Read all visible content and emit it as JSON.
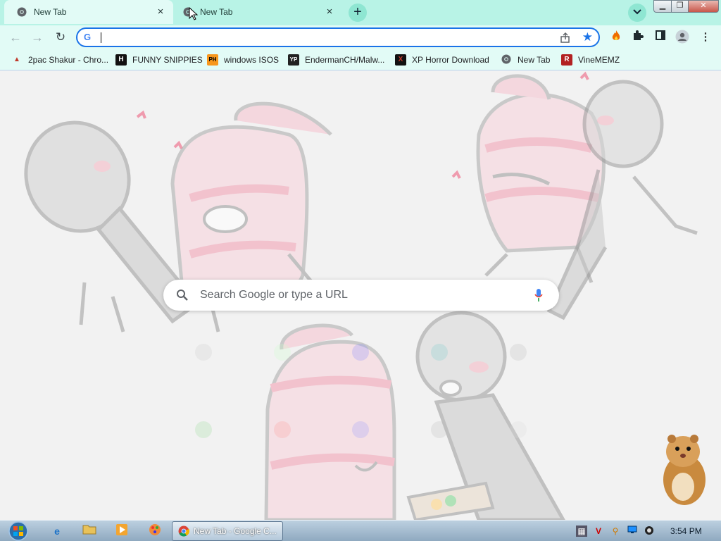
{
  "tabs": [
    {
      "title": "New Tab",
      "active": true
    },
    {
      "title": "New Tab",
      "active": false
    }
  ],
  "tab_actions": {
    "new_tab_symbol": "+",
    "tab_search_symbol": "⌄",
    "close_symbol": "×"
  },
  "window_controls": {
    "minimize": "▁",
    "maximize": "❐",
    "close": "✕"
  },
  "toolbar": {
    "back_symbol": "←",
    "forward_symbol": "→",
    "reload_symbol": "↻",
    "omnibox_value": "",
    "omnibox_logo": "G",
    "star_symbol": "★",
    "menu_symbol": "⋮"
  },
  "bookmarks": [
    {
      "label": "2pac Shakur - Chro...",
      "icon": "bookmark-favicon-2pac",
      "icon_text": "▲",
      "icon_color": "#c0392b"
    },
    {
      "label": "FUNNY SNIPPIES",
      "icon": "bookmark-favicon-h",
      "icon_text": "H",
      "icon_color": "#111111"
    },
    {
      "label": "windows ISOS",
      "icon": "bookmark-favicon-ph",
      "icon_text": "PH",
      "icon_color": "#f7971c"
    },
    {
      "label": "EndermanCH/Malw...",
      "icon": "bookmark-favicon-yp",
      "icon_text": "YP",
      "icon_color": "#222222"
    },
    {
      "label": "XP Horror Download",
      "icon": "bookmark-favicon-x",
      "icon_text": "X",
      "icon_color": "#c0392b"
    },
    {
      "label": "New Tab",
      "icon": "chrome-favicon",
      "icon_text": "◉",
      "icon_color": "#5f6368"
    },
    {
      "label": "VineMEMZ",
      "icon": "bookmark-favicon-r",
      "icon_text": "R",
      "icon_color": "#b22222"
    }
  ],
  "ntp": {
    "search_placeholder": "Search Google or type a URL"
  },
  "taskbar": {
    "window_button_label": "New Tab - Google C...",
    "clock": "3:54 PM"
  },
  "colors": {
    "tabstrip": "#b8f3e6",
    "toolbar": "#e2fbf6",
    "accent": "#1a73e8"
  }
}
